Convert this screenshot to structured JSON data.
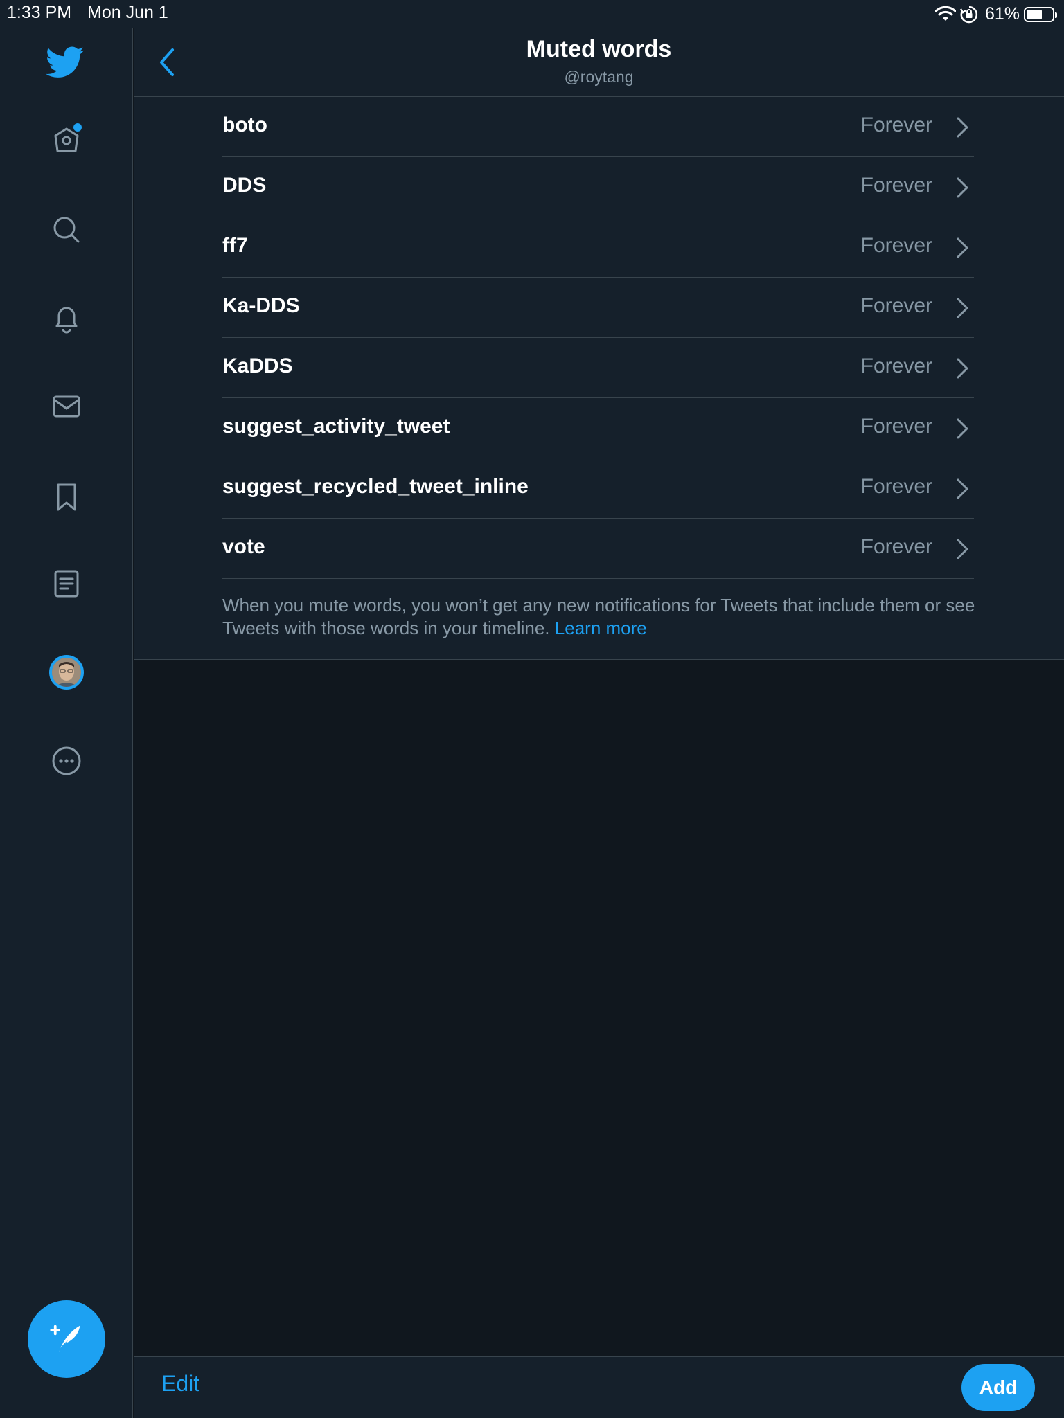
{
  "status_bar": {
    "time": "1:33 PM",
    "date": "Mon Jun 1",
    "battery_percent": "61%",
    "battery_level": 0.61
  },
  "sidebar": {
    "items": [
      {
        "name": "home",
        "icon": "home-icon",
        "has_badge": true
      },
      {
        "name": "explore",
        "icon": "search-icon"
      },
      {
        "name": "notifications",
        "icon": "bell-icon"
      },
      {
        "name": "messages",
        "icon": "mail-icon"
      },
      {
        "name": "bookmarks",
        "icon": "bookmark-icon"
      },
      {
        "name": "lists",
        "icon": "list-icon"
      },
      {
        "name": "profile",
        "icon": "avatar"
      },
      {
        "name": "more",
        "icon": "more-icon"
      }
    ],
    "compose_icon": "compose-tweet-icon"
  },
  "header": {
    "title": "Muted words",
    "subtitle": "@roytang"
  },
  "muted_words": [
    {
      "word": "boto",
      "duration": "Forever"
    },
    {
      "word": "DDS",
      "duration": "Forever"
    },
    {
      "word": "ff7",
      "duration": "Forever"
    },
    {
      "word": "Ka-DDS",
      "duration": "Forever"
    },
    {
      "word": "KaDDS",
      "duration": "Forever"
    },
    {
      "word": "suggest_activity_tweet",
      "duration": "Forever"
    },
    {
      "word": "suggest_recycled_tweet_inline",
      "duration": "Forever"
    },
    {
      "word": "vote",
      "duration": "Forever"
    }
  ],
  "footnote": {
    "text": "When you mute words, you won’t get any new notifications for Tweets that include them or see Tweets with those words in your timeline.",
    "link": "Learn more"
  },
  "bottom_bar": {
    "edit_label": "Edit",
    "add_label": "Add"
  },
  "colors": {
    "accent": "#1da1f2",
    "background": "#15202b",
    "background_dark": "#10171e",
    "secondary_text": "#8899a6",
    "divider": "#38444d"
  }
}
